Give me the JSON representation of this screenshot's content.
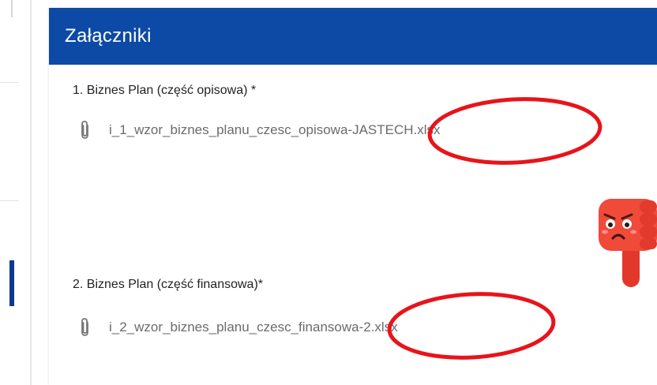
{
  "card": {
    "title": "Załączniki"
  },
  "attachments": [
    {
      "label": "1. Biznes Plan (część opisowa) *",
      "file_name": "i_1_wzor_biznes_planu_czesc_opisowa-JASTECH.xlsx",
      "icon": "paperclip-icon"
    },
    {
      "label": "2. Biznes Plan (część finansowa)*",
      "file_name": "i_2_wzor_biznes_planu_czesc_finansowa-2.xlsx",
      "icon": "paperclip-icon"
    }
  ],
  "colors": {
    "header": "#0d4aa6",
    "annotation": "#e8141b",
    "sidebar_active": "#0b3a8e"
  }
}
